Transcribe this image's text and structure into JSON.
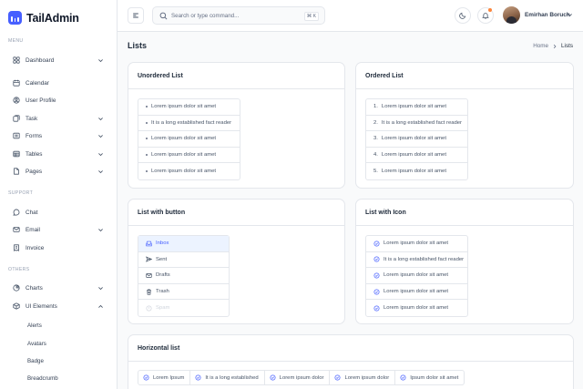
{
  "brand": {
    "name": "TailAdmin"
  },
  "sidebar": {
    "menu_label": "MENU",
    "support_label": "SUPPORT",
    "others_label": "OTHERS",
    "menu_items": [
      {
        "label": "Dashboard",
        "icon": "grid-icon"
      },
      {
        "label": "Calendar",
        "icon": "calendar-icon"
      },
      {
        "label": "User Profile",
        "icon": "user-icon"
      },
      {
        "label": "Task",
        "icon": "task-icon"
      },
      {
        "label": "Forms",
        "icon": "forms-icon"
      },
      {
        "label": "Tables",
        "icon": "table-icon"
      },
      {
        "label": "Pages",
        "icon": "pages-icon"
      }
    ],
    "support_items": [
      {
        "label": "Chat",
        "icon": "chat-icon"
      },
      {
        "label": "Email",
        "icon": "mail-icon"
      },
      {
        "label": "Invoice",
        "icon": "invoice-icon"
      }
    ],
    "others_items": [
      {
        "label": "Charts",
        "icon": "pie-chart-icon"
      },
      {
        "label": "UI Elements",
        "icon": "box-icon"
      }
    ],
    "ui_sub_items": [
      "Alerts",
      "Avatars",
      "Badge",
      "Breadcrumb"
    ]
  },
  "header": {
    "search_placeholder": "Search or type command...",
    "shortcut": "⌘ K",
    "user_name": "Emirhan Boruch"
  },
  "page": {
    "title": "Lists",
    "breadcrumb_home": "Home",
    "breadcrumb_current": "Lists"
  },
  "unordered": {
    "title": "Unordered List",
    "items": [
      "Lorem ipsum dolor sit amet",
      "It is a long established fact reader",
      "Lorem ipsum dolor sit amet",
      "Lorem ipsum dolor sit amet",
      "Lorem ipsum dolor sit amet"
    ]
  },
  "ordered": {
    "title": "Ordered List",
    "items": [
      {
        "num": "1.",
        "text": "Lorem ipsum dolor sit amet"
      },
      {
        "num": "2.",
        "text": "It is a long established fact reader"
      },
      {
        "num": "3.",
        "text": "Lorem ipsum dolor sit amet"
      },
      {
        "num": "4.",
        "text": "Lorem ipsum dolor sit amet"
      },
      {
        "num": "5.",
        "text": "Lorem ipsum dolor sit amet"
      }
    ]
  },
  "button_list": {
    "title": "List with button",
    "items": [
      {
        "label": "Inbox",
        "icon": "inbox-icon",
        "state": "active"
      },
      {
        "label": "Sent",
        "icon": "send-icon",
        "state": "normal"
      },
      {
        "label": "Drafts",
        "icon": "mail-icon",
        "state": "normal"
      },
      {
        "label": "Trash",
        "icon": "trash-icon",
        "state": "normal"
      },
      {
        "label": "Spam",
        "icon": "spam-icon",
        "state": "disabled"
      }
    ]
  },
  "icon_list": {
    "title": "List with Icon",
    "items": [
      "Lorem ipsum dolor sit amet",
      "It is a long established fact reader",
      "Lorem ipsum dolor sit amet",
      "Lorem ipsum dolor sit amet",
      "Lorem ipsum dolor sit amet"
    ]
  },
  "horizontal": {
    "title": "Horizontal list",
    "items": [
      "Lorem Ipsum",
      "It is a long established",
      "Lorem ipsum dolor",
      "Lorem ipsum dolor",
      "Ipsum dolor sit amet"
    ]
  },
  "colors": {
    "accent": "#465fff",
    "active_bg": "#ecf3ff",
    "notification": "#fd853a",
    "border": "#e4e7ec"
  }
}
